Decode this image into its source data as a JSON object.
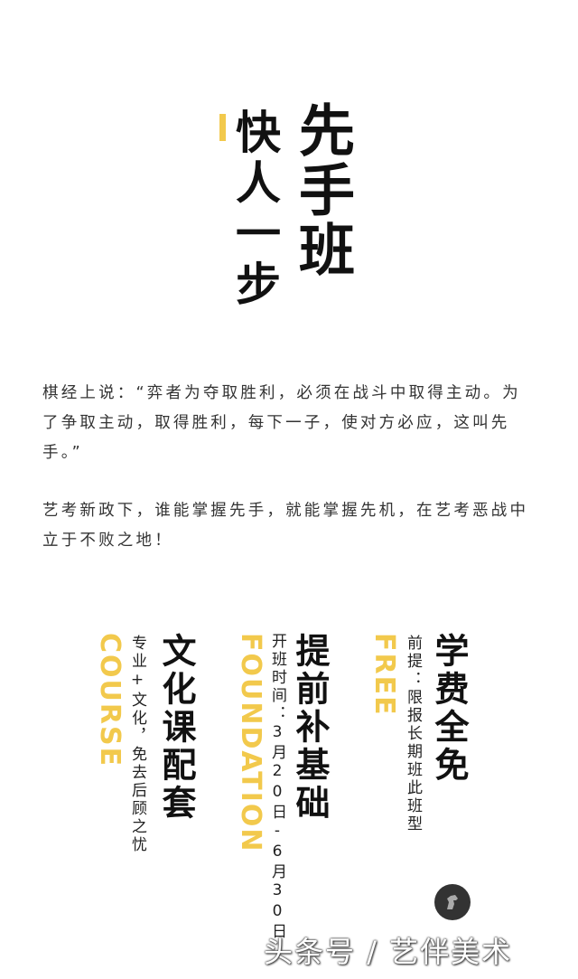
{
  "hero": {
    "line_left": "快人一步",
    "line_right": "先手班"
  },
  "intro": {
    "paragraph1": "棋经上说：“弈者为夺取胜利，必须在战斗中取得主动。为了争取主动，取得胜利，每下一子，使对方必应，这叫先手。”",
    "paragraph2": "艺考新政下，谁能掌握先手，就能掌握先机，在艺考恶战中立于不败之地！"
  },
  "columns": [
    {
      "title": "文化课配套",
      "subtitle": "专业+文化，免去后顾之忧",
      "english": "COURSE"
    },
    {
      "title": "提前补基础",
      "subtitle": "开班时间：3月20日-6月30日",
      "english": "FOUNDATION"
    },
    {
      "title": "学费全免",
      "subtitle": "前提：限报长期班此班型",
      "english": "FREE"
    }
  ],
  "watermark": "头条号 / 艺伴美术",
  "colors": {
    "accent": "#f2c94c",
    "text": "#111111",
    "body_text": "#333333",
    "background": "#ffffff"
  }
}
